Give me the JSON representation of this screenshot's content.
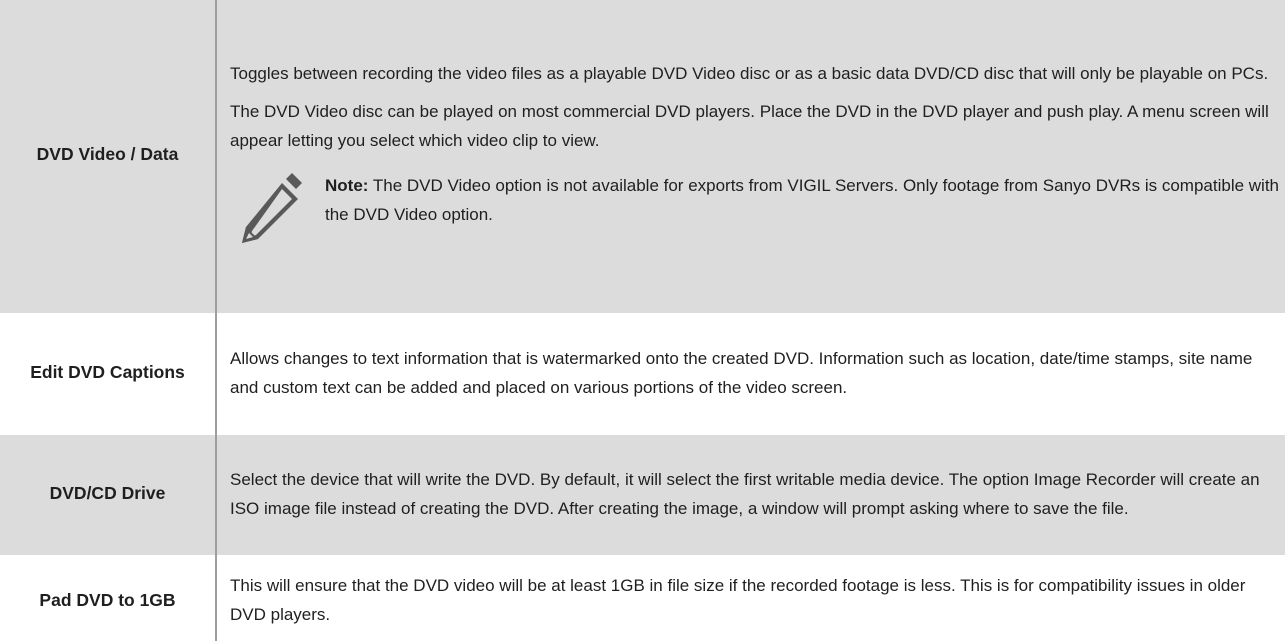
{
  "rows": [
    {
      "term": "DVD Video / Data",
      "paragraphs": [
        "Toggles between recording the video files as a playable DVD Video disc or as a basic data DVD/CD disc that will only be playable on PCs.",
        "The DVD Video disc can be played on most commercial DVD players. Place the DVD in the DVD player and push play. A menu screen will appear letting you select which video clip to view."
      ],
      "note": {
        "icon": "pencil-icon",
        "label": "Note:",
        "text": "The DVD Video option is not available for exports from VIGIL Servers. Only footage from Sanyo DVRs is compatible with the DVD Video option."
      }
    },
    {
      "term": "Edit DVD Captions",
      "paragraphs": [
        "Allows changes to text information that is watermarked onto the created DVD. Information such as location, date/time stamps, site name and custom text can be added and placed on various portions of the video screen."
      ]
    },
    {
      "term": "DVD/CD Drive",
      "paragraphs": [
        "Select the device that will write the DVD. By default, it will select the first writable media device. The option Image Recorder will create an ISO image file instead of creating the DVD. After creating the image, a window will prompt asking where to save the file."
      ]
    },
    {
      "term": "Pad DVD to 1GB",
      "paragraphs": [
        "This will ensure that the DVD video will be at least 1GB in file size if the recorded footage is less. This is for compatibility issues in older DVD players."
      ]
    }
  ],
  "colors": {
    "shaded_row": "#dcdcdc",
    "divider": "#9e9e9e",
    "icon": "#595959"
  }
}
